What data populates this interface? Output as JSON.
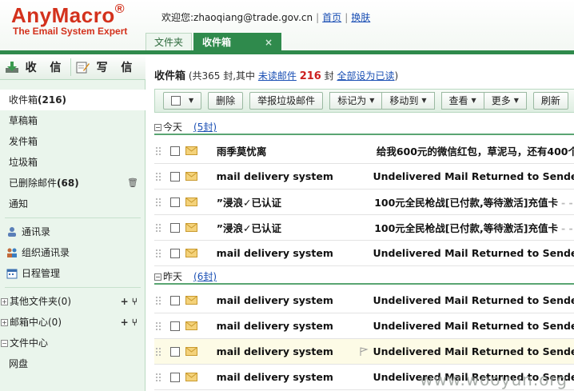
{
  "brand": {
    "logo": "AnyMacro",
    "reg": "®",
    "tagline": "The Email System Expert"
  },
  "header": {
    "welcome": "欢迎您:zhaoqiang@trade.gov.cn",
    "home_link": "首页",
    "skin_link": "换肤",
    "tabs": [
      {
        "label": "文件夹"
      },
      {
        "label": "收件箱",
        "close": "×"
      }
    ]
  },
  "sidebar": {
    "receive_label": "收 信",
    "compose_label": "写 信",
    "folders": [
      {
        "label": "收件箱",
        "count": "(216)"
      },
      {
        "label": "草稿箱"
      },
      {
        "label": "发件箱"
      },
      {
        "label": "垃圾箱"
      },
      {
        "label": "已删除邮件",
        "count": "(68)"
      },
      {
        "label": "通知"
      }
    ],
    "tools": [
      {
        "label": "通讯录",
        "icon": "contacts-icon"
      },
      {
        "label": "组织通讯录",
        "icon": "org-contacts-icon"
      },
      {
        "label": "日程管理",
        "icon": "calendar-icon"
      }
    ],
    "groups": [
      {
        "label": "其他文件夹(0)",
        "toggle": "+",
        "acts": "+ ⑂"
      },
      {
        "label": "邮箱中心(0)",
        "toggle": "+",
        "acts": "+ ⑂"
      },
      {
        "label": "文件中心",
        "toggle": "−"
      }
    ],
    "sub_items": [
      {
        "label": "网盘"
      }
    ]
  },
  "main": {
    "title": "收件箱",
    "summary_a": "(共365 封,其中 ",
    "unread_link": "未读邮件",
    "unread_count": "216",
    "summary_b": " 封 ",
    "mark_all_read": "全部设为已读",
    "summary_c": ")",
    "toolbar": {
      "delete": "删除",
      "report_spam": "举报垃圾邮件",
      "mark_as": "标记为",
      "move_to": "移动到",
      "view": "查看",
      "more": "更多",
      "refresh": "刷新"
    },
    "groups": [
      {
        "label": "今天",
        "count": "(5封)"
      },
      {
        "label": "昨天",
        "count": "(6封)"
      }
    ],
    "today": [
      {
        "sender": "雨季莫忧离",
        "subject": "给我600元的微信红包，草泥马，还有400个"
      },
      {
        "sender": "mail delivery system",
        "subject": "Undelivered Mail Returned to Sender"
      },
      {
        "sender": "”浸浪✓已认证",
        "subject": "100元全民枪战[已付款,等待激活]充值卡",
        "tail": "- - -"
      },
      {
        "sender": "”浸浪✓已认证",
        "subject": "100元全民枪战[已付款,等待激活]充值卡",
        "tail": "- - -"
      },
      {
        "sender": "mail delivery system",
        "subject": "Undelivered Mail Returned to Sender"
      }
    ],
    "yesterday": [
      {
        "sender": "mail delivery system",
        "subject": "Undelivered Mail Returned to Sender"
      },
      {
        "sender": "mail delivery system",
        "subject": "Undelivered Mail Returned to Sender"
      },
      {
        "sender": "mail delivery system",
        "subject": "Undelivered Mail Returned to Sender"
      },
      {
        "sender": "mail delivery system",
        "subject": "Undelivered Mail Returned to Sender"
      }
    ]
  },
  "watermark": "www.wooyun.org",
  "colors": {
    "brand_red": "#d3311c",
    "accent_green": "#2f8a4c",
    "link_blue": "#1a4fb4",
    "unread_red": "#cc1f1f"
  }
}
